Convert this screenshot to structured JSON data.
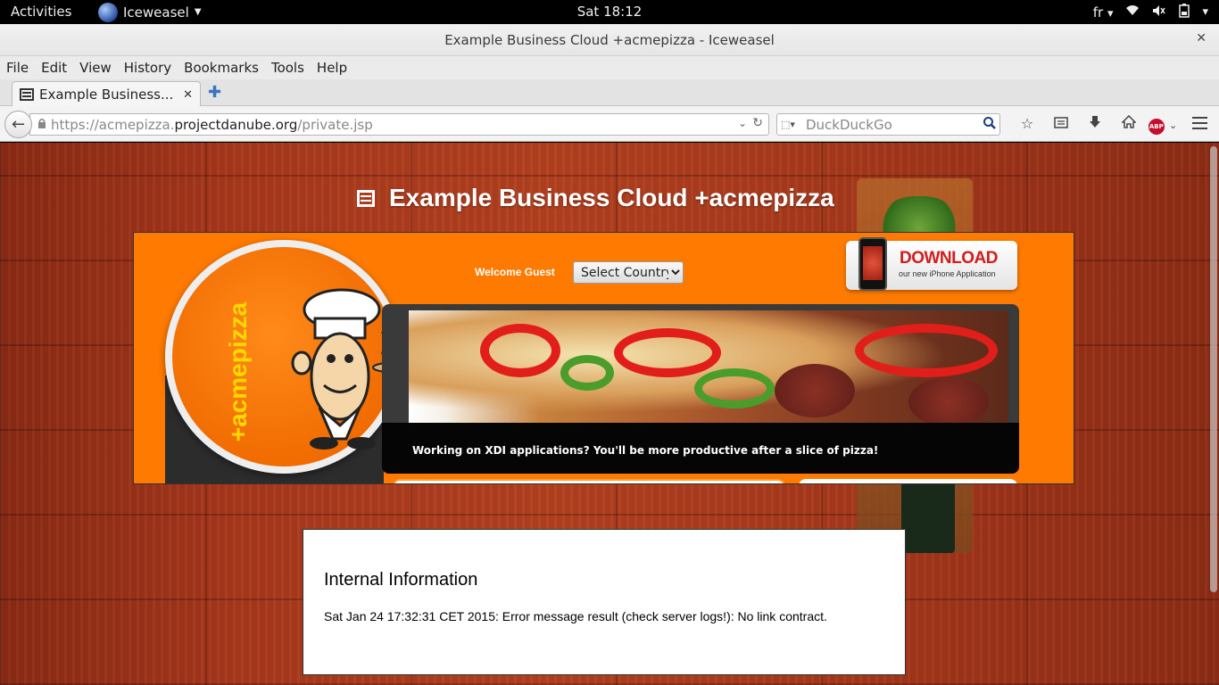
{
  "system_bar": {
    "activities": "Activities",
    "app_name": "Iceweasel",
    "clock": "Sat 18:12",
    "keyboard_layout": "fr"
  },
  "window": {
    "title": "Example Business Cloud +acmepizza - Iceweasel"
  },
  "menu": {
    "items": [
      "File",
      "Edit",
      "View",
      "History",
      "Bookmarks",
      "Tools",
      "Help"
    ]
  },
  "tabs": [
    {
      "label": "Example Business...",
      "active": true
    }
  ],
  "navbar": {
    "url_prefix": "https://acmepizza.",
    "url_domain": "projectdanube.org",
    "url_path": "/private.jsp",
    "search_placeholder": "DuckDuckGo",
    "abp_badge": "ABP"
  },
  "page": {
    "heading": "Example Business Cloud +acmepizza",
    "banner": {
      "logo_text": "+acmepizza",
      "welcome": "Welcome Guest",
      "country_select": "Select Country",
      "download_title": "DOWNLOAD",
      "download_sub": "our new iPhone Application",
      "caption": "Working on XDI applications? You'll be more productive after a slice of pizza!"
    },
    "info": {
      "heading": "Internal Information",
      "message": "Sat Jan 24 17:32:31 CET 2015: Error message result (check server logs!): No link contract."
    }
  },
  "colors": {
    "banner_orange": "#ff7a00",
    "wood": "#a8381c",
    "accent_yellow": "#ffd800",
    "download_red": "#d41c1c"
  },
  "icons": [
    "globe-icon",
    "wifi-icon",
    "volume-icon",
    "battery-icon",
    "tab-page-icon",
    "new-tab-icon",
    "back-icon",
    "lock-icon",
    "reload-icon",
    "search-icon",
    "bookmark-star-icon",
    "reading-list-icon",
    "download-icon",
    "home-icon",
    "adblock-icon",
    "menu-icon"
  ]
}
